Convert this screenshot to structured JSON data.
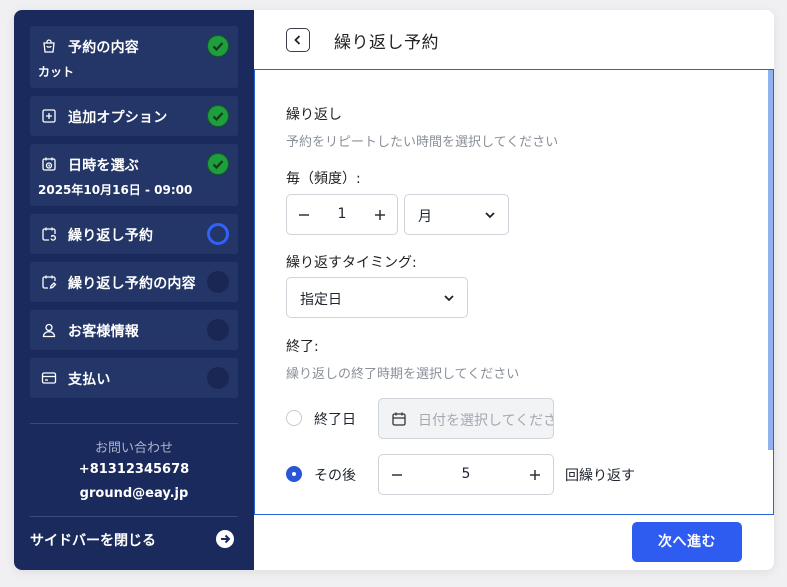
{
  "sidebar": {
    "steps": [
      {
        "label": "予約の内容",
        "sub": "カット",
        "status": "done",
        "icon": "bag-icon"
      },
      {
        "label": "追加オプション",
        "sub": "",
        "status": "done",
        "icon": "plus-square-icon"
      },
      {
        "label": "日時を選ぶ",
        "sub": "2025年10月16日 - 09:00",
        "status": "done",
        "icon": "calendar-clock-icon"
      },
      {
        "label": "繰り返し予約",
        "sub": "",
        "status": "current",
        "icon": "calendar-repeat-icon"
      },
      {
        "label": "繰り返し予約の内容",
        "sub": "",
        "status": "pending",
        "icon": "calendar-edit-icon"
      },
      {
        "label": "お客様情報",
        "sub": "",
        "status": "pending",
        "icon": "user-icon"
      },
      {
        "label": "支払い",
        "sub": "",
        "status": "pending",
        "icon": "credit-card-icon"
      }
    ],
    "contact": {
      "title": "お問い合わせ",
      "phone": "+81312345678",
      "email": "ground@eay.jp"
    },
    "close_label": "サイドバーを閉じる"
  },
  "main": {
    "title": "繰り返し予約",
    "repeat": {
      "heading": "繰り返し",
      "hint": "予約をリピートしたい時間を選択してください"
    },
    "frequency": {
      "label": "毎（頻度）:",
      "value": "1",
      "unit": "月"
    },
    "timing": {
      "label": "繰り返すタイミング:",
      "value": "指定日"
    },
    "end": {
      "label": "終了:",
      "hint": "繰り返しの終了時期を選択してください",
      "end_date_label": "終了日",
      "end_date_placeholder": "日付を選択してください",
      "after_label": "その後",
      "after_value": "5",
      "after_suffix": "回繰り返す",
      "selected": "after"
    },
    "next_label": "次へ進む"
  },
  "colors": {
    "sidebar_bg": "#1b2a5c",
    "step_bg": "#243567",
    "done": "#1e9e3e",
    "accent": "#2e5bf0"
  }
}
